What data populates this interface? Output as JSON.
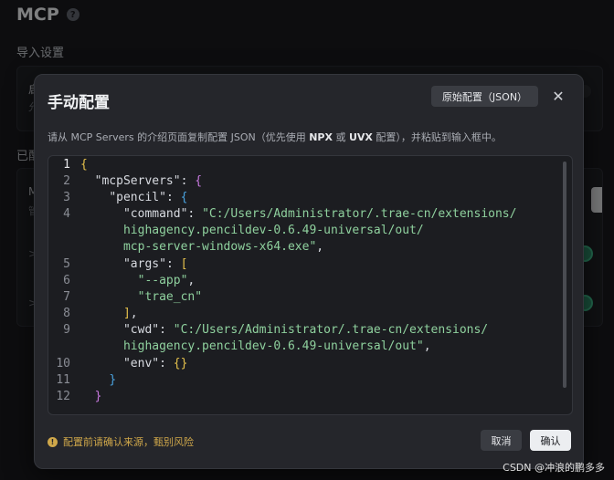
{
  "background": {
    "title": "MCP",
    "section_import": "导入设置",
    "card_line1": "启",
    "card_line2": "允",
    "section_added": "已配",
    "list_line1": "M",
    "list_line2": "管",
    "chevron1": ">",
    "chevron2": ">"
  },
  "dialog": {
    "title": "手动配置",
    "raw_config_button": "原始配置（JSON）",
    "close_label": "✕",
    "description": {
      "part1": "请从 MCP Servers 的介绍页面复制配置 JSON（优先使用 ",
      "npx": "NPX",
      "part2": " 或 ",
      "uvx": "UVX",
      "part3": " 配置），并粘贴到输入框中。"
    },
    "editor": {
      "line_numbers": [
        "1",
        "2",
        "3",
        "4",
        "",
        "",
        "5",
        "6",
        "7",
        "8",
        "9",
        "",
        "10",
        "11",
        "12"
      ],
      "code": {
        "l1": "{",
        "l2_key": "\"mcpServers\"",
        "l3_key": "\"pencil\"",
        "l4_key": "\"command\"",
        "l4_val": "\"C:/Users/Administrator/.trae-cn/extensions/",
        "l4_val2": "highagency.pencildev-0.6.49-universal/out/",
        "l4_val3": "mcp-server-windows-x64.exe\"",
        "l5_key": "\"args\"",
        "l6_val": "\"--app\"",
        "l7_val": "\"trae_cn\"",
        "l8": "],",
        "l9_key": "\"cwd\"",
        "l9_val": "\"C:/Users/Administrator/.trae-cn/extensions/",
        "l9_val2": "highagency.pencildev-0.6.49-universal/out\"",
        "l10_key": "\"env\"",
        "l10_val": "{}",
        "l11": "}",
        "l12": "}"
      }
    },
    "warning": "配置前请确认来源，甄别风险",
    "cancel_button": "取消",
    "confirm_button": "确认"
  },
  "watermark": "CSDN @冲浪的鹏多多",
  "colors": {
    "accent_string": "#8fd19e",
    "bracket_yellow": "#e5c14c",
    "bracket_purple": "#c678dd",
    "bracket_blue": "#4aa3df",
    "warning": "#cfa74a"
  }
}
